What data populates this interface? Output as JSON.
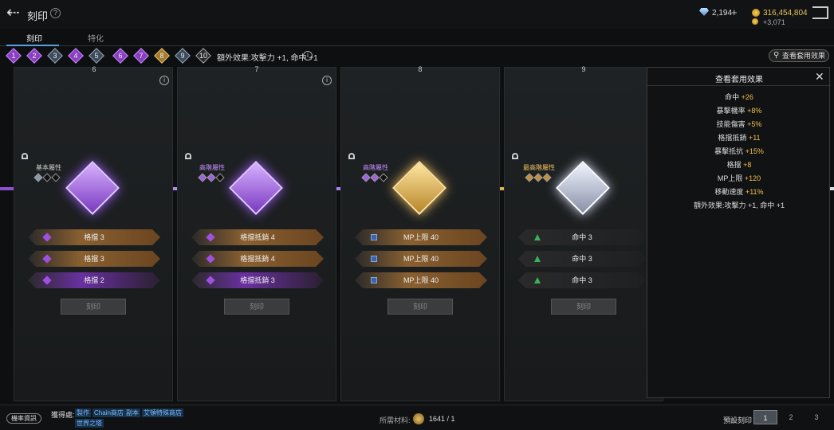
{
  "header": {
    "title": "刻印",
    "help": "?",
    "gems": "2,194",
    "plus": "+",
    "gold": "316,454,804",
    "gold_sub": "+3,071"
  },
  "tabs": [
    {
      "label": "刻印"
    },
    {
      "label": "特化"
    }
  ],
  "stages": [
    "1",
    "2",
    "3",
    "4",
    "5",
    "6",
    "7",
    "8",
    "9",
    "10"
  ],
  "extra_effect": "額外效果:攻擊力 +1, 命中 +1",
  "info": "i",
  "view_button": "查看套用效果",
  "panels": [
    {
      "num": "6",
      "rank": "基本屬性",
      "lines": [
        "格擋 3",
        "格擋 3",
        "格擋 2"
      ],
      "button": "刻印"
    },
    {
      "num": "7",
      "rank": "高階屬性",
      "lines": [
        "格擋抵銷 4",
        "格擋抵銷 4",
        "格擋抵銷 3"
      ],
      "button": "刻印"
    },
    {
      "num": "8",
      "rank": "高階屬性",
      "lines": [
        "MP上限 40",
        "MP上限 40",
        "MP上限 40"
      ],
      "button": "刻印"
    },
    {
      "num": "9",
      "rank": "最高階屬性",
      "lines": [
        "命中 3",
        "命中 3",
        "命中 3"
      ],
      "button": "刻印"
    }
  ],
  "overlay": {
    "title": "查看套用效果",
    "close": "✕",
    "effects": [
      {
        "name": "命中",
        "value": "+26"
      },
      {
        "name": "暴擊機率",
        "value": "+8%"
      },
      {
        "name": "技能傷害",
        "value": "+5%"
      },
      {
        "name": "格擋抵銷",
        "value": "+11"
      },
      {
        "name": "暴擊抵抗",
        "value": "+15%"
      },
      {
        "name": "格擋",
        "value": "+8"
      },
      {
        "name": "MP上限",
        "value": "+120"
      },
      {
        "name": "移動速度",
        "value": "+11%"
      }
    ],
    "extra": "額外效果:攻擊力 +1, 命中 +1"
  },
  "bottom": {
    "prob": "機率資訊",
    "source": "獲得處:",
    "links": [
      "製作",
      "Chain商店",
      "副本",
      "艾頓特殊商店",
      "世界之塔"
    ],
    "material_label": "所需材料:",
    "material_value": "1641 / 1",
    "preset_label": "預設刻印",
    "presets": [
      "1",
      "2",
      "3"
    ]
  }
}
